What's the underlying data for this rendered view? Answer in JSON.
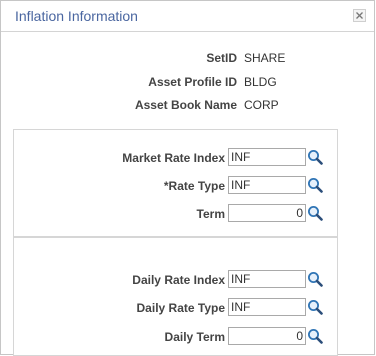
{
  "dialog": {
    "title": "Inflation Information"
  },
  "header_info": [
    {
      "label": "SetID",
      "value": "SHARE"
    },
    {
      "label": "Asset Profile ID",
      "value": "BLDG"
    },
    {
      "label": "Asset Book Name",
      "value": "CORP"
    }
  ],
  "market_group": {
    "fields": [
      {
        "label": "Market Rate Index",
        "value": "INF"
      },
      {
        "label": "*Rate Type",
        "value": "INF"
      },
      {
        "label": "Term",
        "value": "0"
      }
    ]
  },
  "daily_group": {
    "fields": [
      {
        "label": "Daily Rate Index",
        "value": "INF"
      },
      {
        "label": "Daily Rate Type",
        "value": "INF"
      },
      {
        "label": "Daily Term",
        "value": "0"
      }
    ]
  },
  "icons": {
    "lookup": "magnifier-lookup-icon",
    "close": "close-icon"
  },
  "colors": {
    "title": "#4a66a0",
    "border": "#c6c6c6",
    "lookup_lens": "#2f74b5"
  }
}
